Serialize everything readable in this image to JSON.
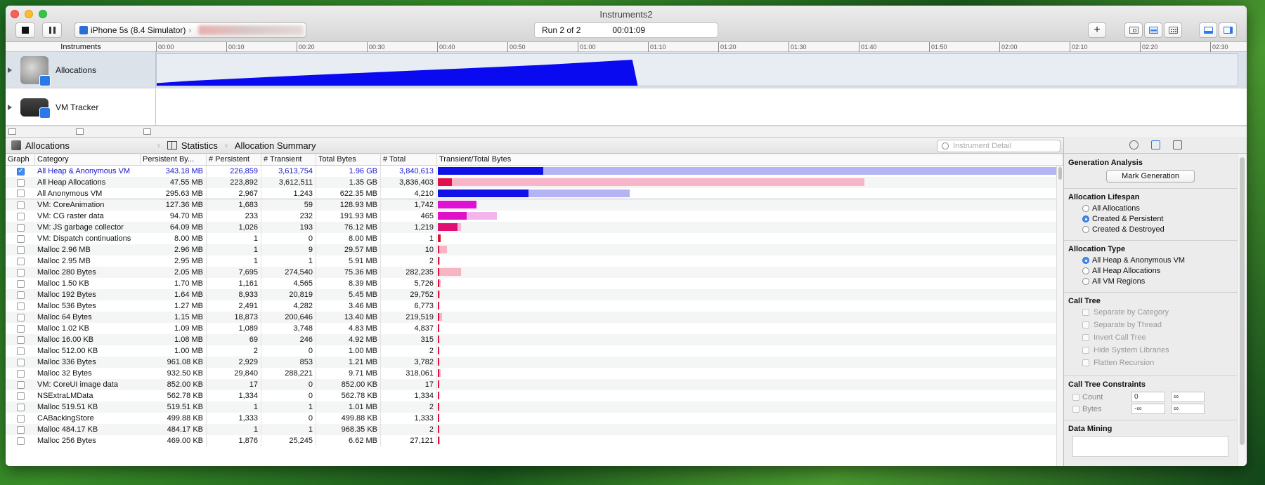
{
  "window": {
    "title": "Instruments2"
  },
  "toolbar": {
    "device": "iPhone 5s (8.4 Simulator)",
    "chevron": "›",
    "run_label": "Run 2 of 2",
    "elapsed": "00:01:09",
    "plus": "+"
  },
  "timeline": {
    "instruments_header": "Instruments",
    "ticks": [
      "00:00",
      "00:10",
      "00:20",
      "00:30",
      "00:40",
      "00:50",
      "01:00",
      "01:10",
      "01:20",
      "01:30",
      "01:40",
      "01:50",
      "02:00",
      "02:10",
      "02:20",
      "02:30"
    ],
    "tracks": [
      {
        "name": "Allocations"
      },
      {
        "name": "VM Tracker"
      }
    ]
  },
  "jumpbar": {
    "items": [
      "Allocations",
      "Statistics",
      "Allocation Summary"
    ],
    "search_placeholder": "Instrument Detail"
  },
  "table": {
    "headers": [
      "Graph",
      "Category",
      "Persistent By...",
      "# Persistent",
      "# Transient",
      "Total Bytes",
      "# Total",
      "Transient/Total Bytes"
    ],
    "rows": [
      {
        "checked": true,
        "category": "All Heap & Anonymous VM",
        "persistent_bytes": "343.18 MB",
        "n_persistent": "226,859",
        "n_transient": "3,613,754",
        "total_bytes": "1.96 GB",
        "n_total": "3,840,613",
        "bar_total": 1.0,
        "bar_persist": 0.17,
        "color": "#1010e8",
        "light": "#b4b4f4"
      },
      {
        "checked": false,
        "category": "All Heap Allocations",
        "persistent_bytes": "47.55 MB",
        "n_persistent": "223,892",
        "n_transient": "3,612,511",
        "total_bytes": "1.35 GB",
        "n_total": "3,836,403",
        "bar_total": 0.69,
        "bar_persist": 0.023,
        "color": "#e0104a",
        "light": "#f8b4c8"
      },
      {
        "checked": false,
        "category": "All Anonymous VM",
        "persistent_bytes": "295.63 MB",
        "n_persistent": "2,967",
        "n_transient": "1,243",
        "total_bytes": "622.35 MB",
        "n_total": "4,210",
        "bar_total": 0.31,
        "bar_persist": 0.147,
        "color": "#1010e8",
        "light": "#b4b4f4"
      },
      {
        "checked": false,
        "category": "VM: CoreAnimation",
        "persistent_bytes": "127.36 MB",
        "n_persistent": "1,683",
        "n_transient": "59",
        "total_bytes": "128.93 MB",
        "n_total": "1,742",
        "bar_total": 0.063,
        "bar_persist": 0.062,
        "color": "#e010d8",
        "light": "#f4b4f0"
      },
      {
        "checked": false,
        "category": "VM: CG raster data",
        "persistent_bytes": "94.70 MB",
        "n_persistent": "233",
        "n_transient": "232",
        "total_bytes": "191.93 MB",
        "n_total": "465",
        "bar_total": 0.095,
        "bar_persist": 0.047,
        "color": "#e010c8",
        "light": "#f4b4ec"
      },
      {
        "checked": false,
        "category": "VM: JS garbage collector",
        "persistent_bytes": "64.09 MB",
        "n_persistent": "1,026",
        "n_transient": "193",
        "total_bytes": "76.12 MB",
        "n_total": "1,219",
        "bar_total": 0.038,
        "bar_persist": 0.032,
        "color": "#e01070",
        "light": "#f4b4d4"
      },
      {
        "checked": false,
        "category": "VM: Dispatch continuations",
        "persistent_bytes": "8.00 MB",
        "n_persistent": "1",
        "n_transient": "0",
        "total_bytes": "8.00 MB",
        "n_total": "1",
        "bar_total": 0.004,
        "bar_persist": 0.004,
        "color": "#e01030",
        "light": "#f4b4bc"
      },
      {
        "checked": false,
        "category": "Malloc 2.96 MB",
        "persistent_bytes": "2.96 MB",
        "n_persistent": "1",
        "n_transient": "9",
        "total_bytes": "29.57 MB",
        "n_total": "10",
        "bar_total": 0.015,
        "bar_persist": 0.0015,
        "color": "#e01040",
        "light": "#f8b4c0"
      },
      {
        "checked": false,
        "category": "Malloc 2.95 MB",
        "persistent_bytes": "2.95 MB",
        "n_persistent": "1",
        "n_transient": "1",
        "total_bytes": "5.91 MB",
        "n_total": "2",
        "bar_total": 0.003,
        "bar_persist": 0.0015,
        "color": "#e01040",
        "light": "#f8b4c0"
      },
      {
        "checked": false,
        "category": "Malloc 280 Bytes",
        "persistent_bytes": "2.05 MB",
        "n_persistent": "7,695",
        "n_transient": "274,540",
        "total_bytes": "75.36 MB",
        "n_total": "282,235",
        "bar_total": 0.037,
        "bar_persist": 0.001,
        "color": "#e01040",
        "light": "#f8b4c0"
      },
      {
        "checked": false,
        "category": "Malloc 1.50 KB",
        "persistent_bytes": "1.70 MB",
        "n_persistent": "1,161",
        "n_transient": "4,565",
        "total_bytes": "8.39 MB",
        "n_total": "5,726",
        "bar_total": 0.004,
        "bar_persist": 0.001,
        "color": "#e01040",
        "light": "#f8b4c0"
      },
      {
        "checked": false,
        "category": "Malloc 192 Bytes",
        "persistent_bytes": "1.64 MB",
        "n_persistent": "8,933",
        "n_transient": "20,819",
        "total_bytes": "5.45 MB",
        "n_total": "29,752",
        "bar_total": 0.003,
        "bar_persist": 0.001,
        "color": "#e01040",
        "light": "#f8b4c0"
      },
      {
        "checked": false,
        "category": "Malloc 536 Bytes",
        "persistent_bytes": "1.27 MB",
        "n_persistent": "2,491",
        "n_transient": "4,282",
        "total_bytes": "3.46 MB",
        "n_total": "6,773",
        "bar_total": 0.002,
        "bar_persist": 0.001,
        "color": "#e01040",
        "light": "#f8b4c0"
      },
      {
        "checked": false,
        "category": "Malloc 64 Bytes",
        "persistent_bytes": "1.15 MB",
        "n_persistent": "18,873",
        "n_transient": "200,646",
        "total_bytes": "13.40 MB",
        "n_total": "219,519",
        "bar_total": 0.007,
        "bar_persist": 0.001,
        "color": "#e01040",
        "light": "#f8b4c0"
      },
      {
        "checked": false,
        "category": "Malloc 1.02 KB",
        "persistent_bytes": "1.09 MB",
        "n_persistent": "1,089",
        "n_transient": "3,748",
        "total_bytes": "4.83 MB",
        "n_total": "4,837",
        "bar_total": 0.0024,
        "bar_persist": 0.0005,
        "color": "#e01040",
        "light": "#f8b4c0"
      },
      {
        "checked": false,
        "category": "Malloc 16.00 KB",
        "persistent_bytes": "1.08 MB",
        "n_persistent": "69",
        "n_transient": "246",
        "total_bytes": "4.92 MB",
        "n_total": "315",
        "bar_total": 0.0024,
        "bar_persist": 0.0005,
        "color": "#e01040",
        "light": "#f8b4c0"
      },
      {
        "checked": false,
        "category": "Malloc 512.00 KB",
        "persistent_bytes": "1.00 MB",
        "n_persistent": "2",
        "n_transient": "0",
        "total_bytes": "1.00 MB",
        "n_total": "2",
        "bar_total": 0.0005,
        "bar_persist": 0.0005,
        "color": "#e01040",
        "light": "#f8b4c0"
      },
      {
        "checked": false,
        "category": "Malloc 336 Bytes",
        "persistent_bytes": "961.08 KB",
        "n_persistent": "2,929",
        "n_transient": "853",
        "total_bytes": "1.21 MB",
        "n_total": "3,782",
        "bar_total": 0.0006,
        "bar_persist": 0.0005,
        "color": "#e01040",
        "light": "#f8b4c0"
      },
      {
        "checked": false,
        "category": "Malloc 32 Bytes",
        "persistent_bytes": "932.50 KB",
        "n_persistent": "29,840",
        "n_transient": "288,221",
        "total_bytes": "9.71 MB",
        "n_total": "318,061",
        "bar_total": 0.005,
        "bar_persist": 0.0005,
        "color": "#e01040",
        "light": "#f8b4c0"
      },
      {
        "checked": false,
        "category": "VM: CoreUI image data",
        "persistent_bytes": "852.00 KB",
        "n_persistent": "17",
        "n_transient": "0",
        "total_bytes": "852.00 KB",
        "n_total": "17",
        "bar_total": 0.0004,
        "bar_persist": 0.0004,
        "color": "#e01040",
        "light": "#f8b4c0"
      },
      {
        "checked": false,
        "category": "NSExtraLMData",
        "persistent_bytes": "562.78 KB",
        "n_persistent": "1,334",
        "n_transient": "0",
        "total_bytes": "562.78 KB",
        "n_total": "1,334",
        "bar_total": 0.0003,
        "bar_persist": 0.0003,
        "color": "#e01040",
        "light": "#f8b4c0"
      },
      {
        "checked": false,
        "category": "Malloc 519.51 KB",
        "persistent_bytes": "519.51 KB",
        "n_persistent": "1",
        "n_transient": "1",
        "total_bytes": "1.01 MB",
        "n_total": "2",
        "bar_total": 0.0005,
        "bar_persist": 0.0003,
        "color": "#e01040",
        "light": "#f8b4c0"
      },
      {
        "checked": false,
        "category": "CABackingStore",
        "persistent_bytes": "499.88 KB",
        "n_persistent": "1,333",
        "n_transient": "0",
        "total_bytes": "499.88 KB",
        "n_total": "1,333",
        "bar_total": 0.0003,
        "bar_persist": 0.0003,
        "color": "#e01040",
        "light": "#f8b4c0"
      },
      {
        "checked": false,
        "category": "Malloc 484.17 KB",
        "persistent_bytes": "484.17 KB",
        "n_persistent": "1",
        "n_transient": "1",
        "total_bytes": "968.35 KB",
        "n_total": "2",
        "bar_total": 0.0005,
        "bar_persist": 0.0003,
        "color": "#e01040",
        "light": "#f8b4c0"
      },
      {
        "checked": false,
        "category": "Malloc 256 Bytes",
        "persistent_bytes": "469.00 KB",
        "n_persistent": "1,876",
        "n_transient": "25,245",
        "total_bytes": "6.62 MB",
        "n_total": "27,121",
        "bar_total": 0.0034,
        "bar_persist": 0.0003,
        "color": "#e01040",
        "light": "#f8b4c0"
      }
    ]
  },
  "inspector": {
    "generation": {
      "title": "Generation Analysis",
      "button": "Mark Generation"
    },
    "lifespan": {
      "title": "Allocation Lifespan",
      "options": [
        "All Allocations",
        "Created & Persistent",
        "Created & Destroyed"
      ],
      "selected": 1
    },
    "type": {
      "title": "Allocation Type",
      "options": [
        "All Heap & Anonymous VM",
        "All Heap Allocations",
        "All VM Regions"
      ],
      "selected": 0
    },
    "calltree": {
      "title": "Call Tree",
      "options": [
        "Separate by Category",
        "Separate by Thread",
        "Invert Call Tree",
        "Hide System Libraries",
        "Flatten Recursion"
      ]
    },
    "constraints": {
      "title": "Call Tree Constraints",
      "count_label": "Count",
      "count_min": "0",
      "count_max": "∞",
      "bytes_label": "Bytes",
      "bytes_min": "-∞",
      "bytes_max": "∞"
    },
    "datamining": {
      "title": "Data Mining"
    }
  },
  "colors": {
    "graph_fill": "#0a0af0",
    "selection_text": "#1515d0"
  }
}
